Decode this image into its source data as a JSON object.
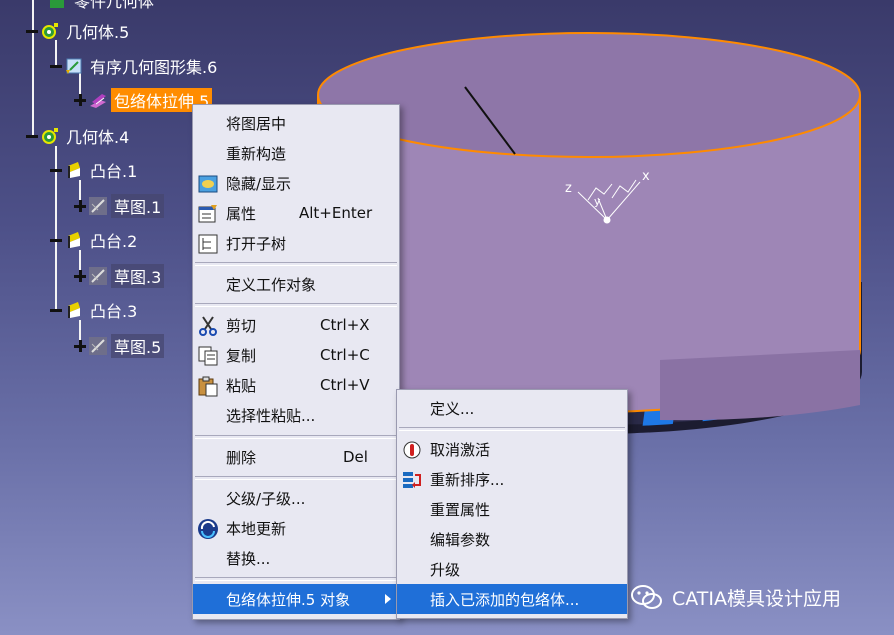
{
  "tree": {
    "top_partial": "零件几何体",
    "items": [
      {
        "label": "几何体.5"
      },
      {
        "label": "有序几何图形集.6"
      },
      {
        "label": "包络体拉伸.5"
      },
      {
        "label": "几何体.4"
      },
      {
        "label": "凸台.1"
      },
      {
        "label": "草图.1"
      },
      {
        "label": "凸台.2"
      },
      {
        "label": "草图.3"
      },
      {
        "label": "凸台.3"
      },
      {
        "label": "草图.5"
      }
    ]
  },
  "context_menu": {
    "items": [
      {
        "label": "将图居中",
        "shortcut": ""
      },
      {
        "label": "重新构造",
        "shortcut": ""
      },
      {
        "label": "隐藏/显示",
        "shortcut": ""
      },
      {
        "label": "属性",
        "shortcut": "Alt+Enter"
      },
      {
        "label": "打开子树",
        "shortcut": ""
      },
      {
        "label": "定义工作对象",
        "shortcut": ""
      },
      {
        "label": "剪切",
        "shortcut": "Ctrl+X"
      },
      {
        "label": "复制",
        "shortcut": "Ctrl+C"
      },
      {
        "label": "粘贴",
        "shortcut": "Ctrl+V"
      },
      {
        "label": "选择性粘贴...",
        "shortcut": ""
      },
      {
        "label": "删除",
        "shortcut": "Del"
      },
      {
        "label": "父级/子级...",
        "shortcut": ""
      },
      {
        "label": "本地更新",
        "shortcut": ""
      },
      {
        "label": "替换...",
        "shortcut": ""
      },
      {
        "label": "包络体拉伸.5 对象",
        "shortcut": ""
      }
    ]
  },
  "submenu": {
    "items": [
      {
        "label": "定义..."
      },
      {
        "label": "取消激活"
      },
      {
        "label": "重新排序..."
      },
      {
        "label": "重置属性"
      },
      {
        "label": "编辑参数"
      },
      {
        "label": "升级"
      },
      {
        "label": "插入已添加的包络体..."
      }
    ]
  },
  "axis_labels": {
    "x": "x",
    "y": "y",
    "z": "z"
  },
  "watermark": "CATIA模具设计应用",
  "colors": {
    "selection": "#ff8c00",
    "menu_highlight": "#1f6fd8",
    "cylinder_top": "#8e76a8",
    "stripe_blue": "#1e78e6"
  }
}
